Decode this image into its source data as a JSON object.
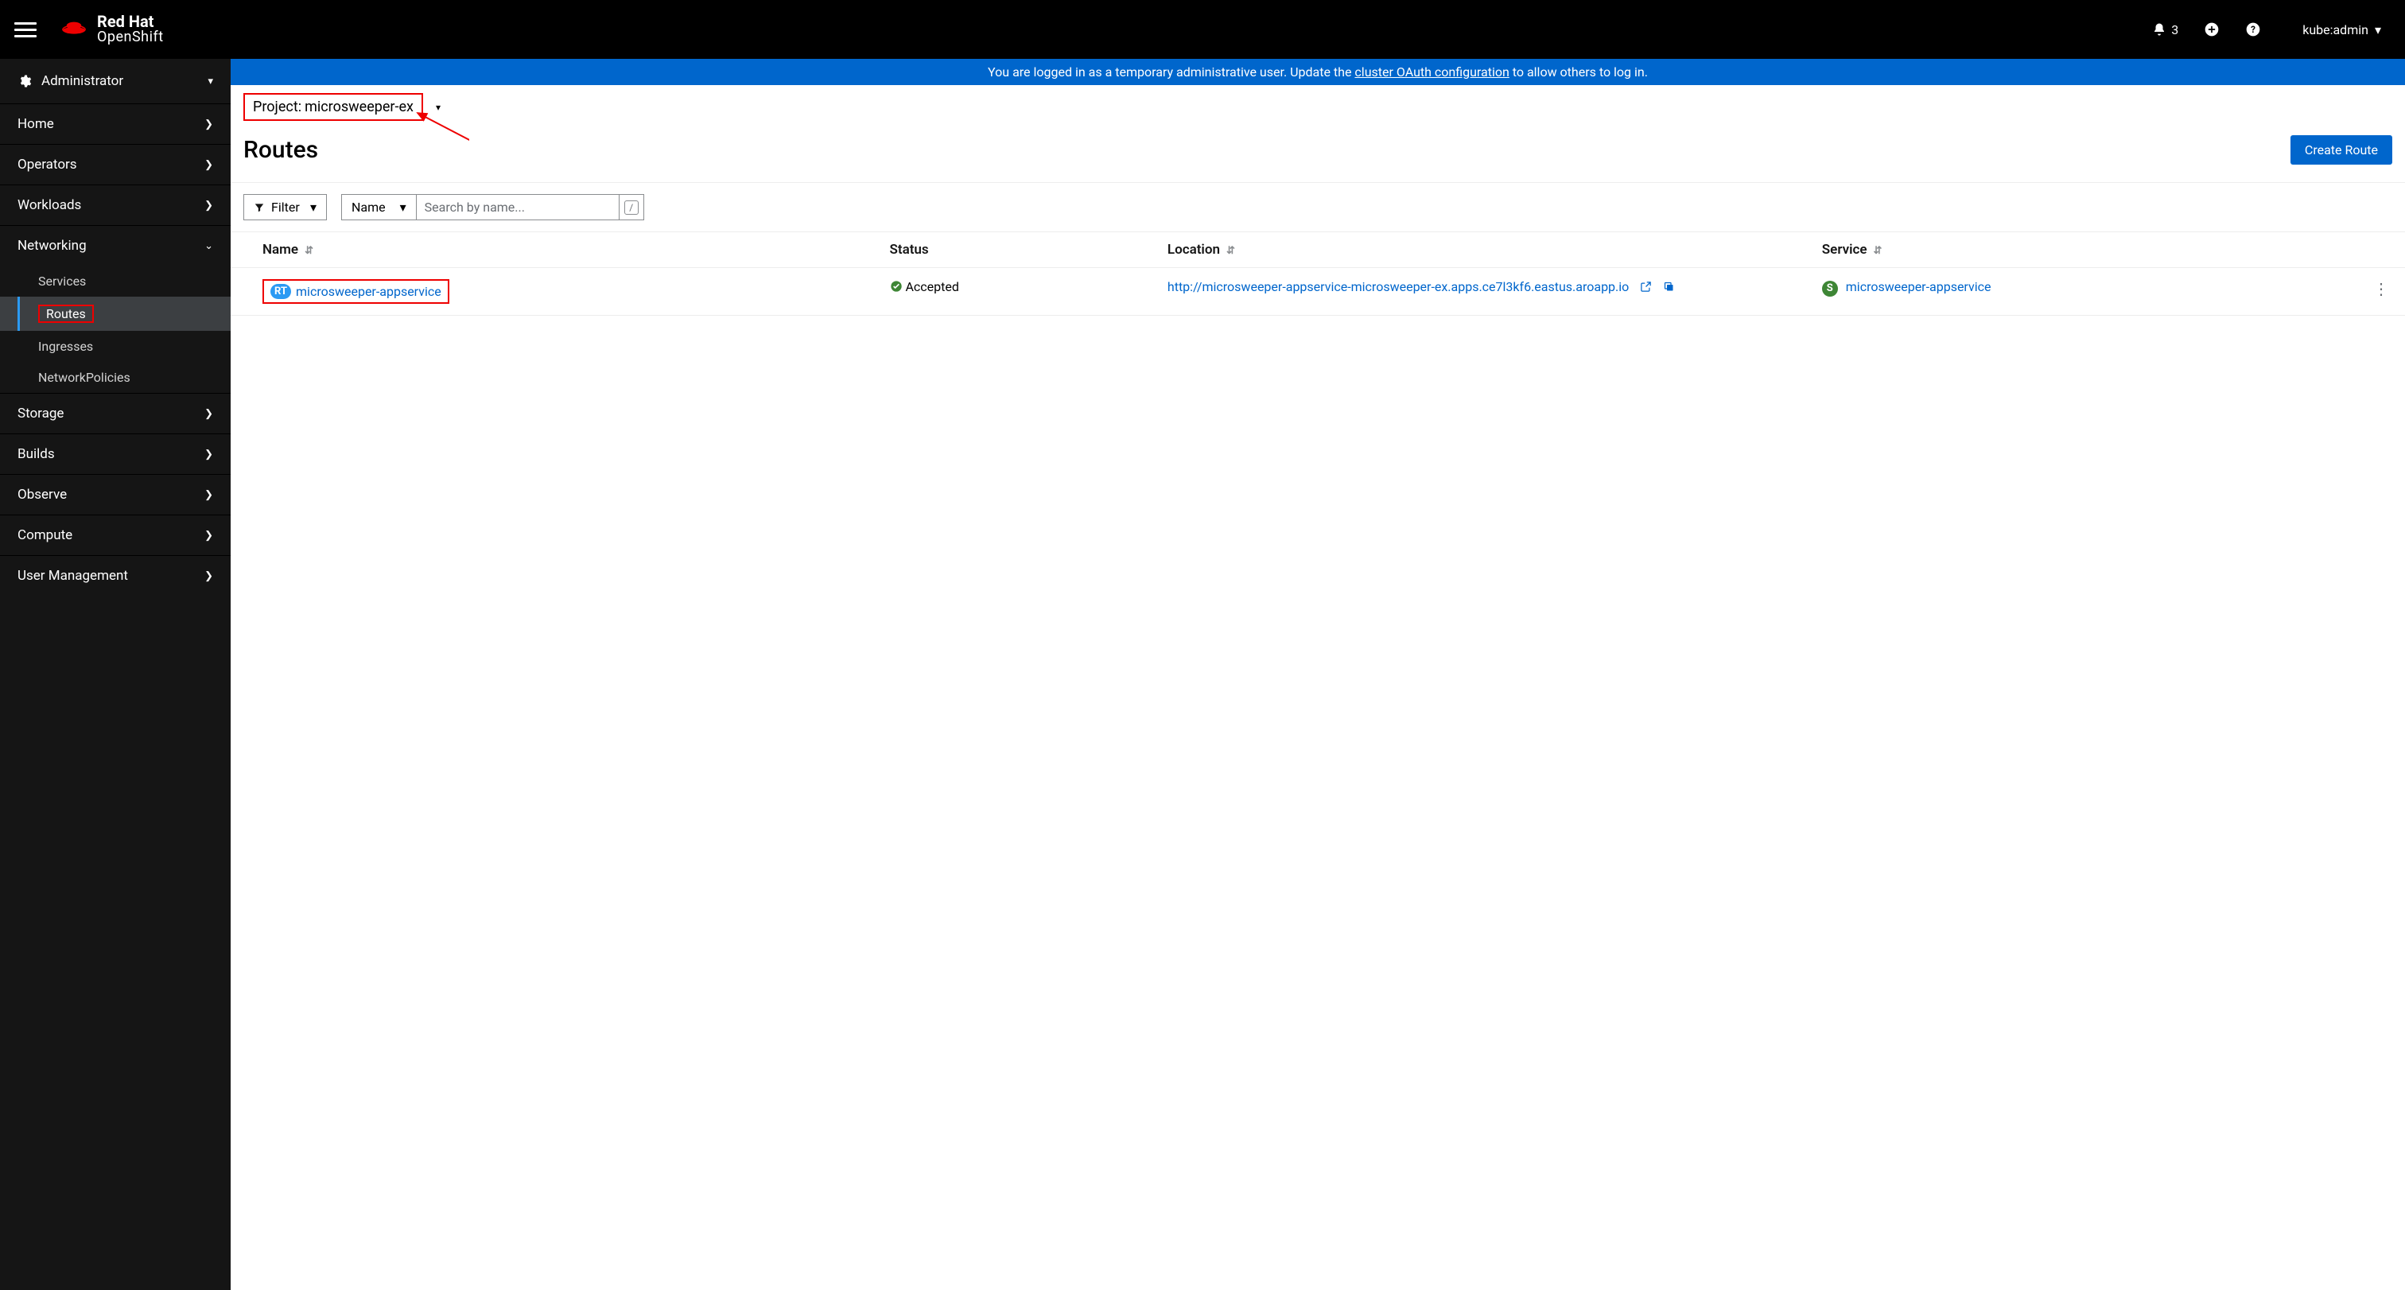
{
  "brand": {
    "line1": "Red Hat",
    "line2": "OpenShift"
  },
  "masthead": {
    "notification_count": "3",
    "username": "kube:admin"
  },
  "sidebar": {
    "perspective": "Administrator",
    "items": [
      {
        "label": "Home"
      },
      {
        "label": "Operators"
      },
      {
        "label": "Workloads"
      },
      {
        "label": "Networking",
        "expanded": true,
        "children": [
          {
            "label": "Services"
          },
          {
            "label": "Routes",
            "active": true
          },
          {
            "label": "Ingresses"
          },
          {
            "label": "NetworkPolicies"
          }
        ]
      },
      {
        "label": "Storage"
      },
      {
        "label": "Builds"
      },
      {
        "label": "Observe"
      },
      {
        "label": "Compute"
      },
      {
        "label": "User Management"
      }
    ]
  },
  "banner": {
    "prefix": "You are logged in as a temporary administrative user. Update the ",
    "link": "cluster OAuth configuration",
    "suffix": " to allow others to log in."
  },
  "project": {
    "label_prefix": "Project: ",
    "name": "microsweeper-ex"
  },
  "page": {
    "title": "Routes",
    "create_button": "Create Route"
  },
  "toolbar": {
    "filter": "Filter",
    "name_label": "Name",
    "search_placeholder": "Search by name...",
    "slash": "/"
  },
  "table": {
    "columns": {
      "name": "Name",
      "status": "Status",
      "location": "Location",
      "service": "Service"
    },
    "row": {
      "badge": "RT",
      "name": "microsweeper-appservice",
      "status": "Accepted",
      "location": "http://microsweeper-appservice-microsweeper-ex.apps.ce7l3kf6.eastus.aroapp.io",
      "service_badge": "S",
      "service": "microsweeper-appservice"
    }
  }
}
